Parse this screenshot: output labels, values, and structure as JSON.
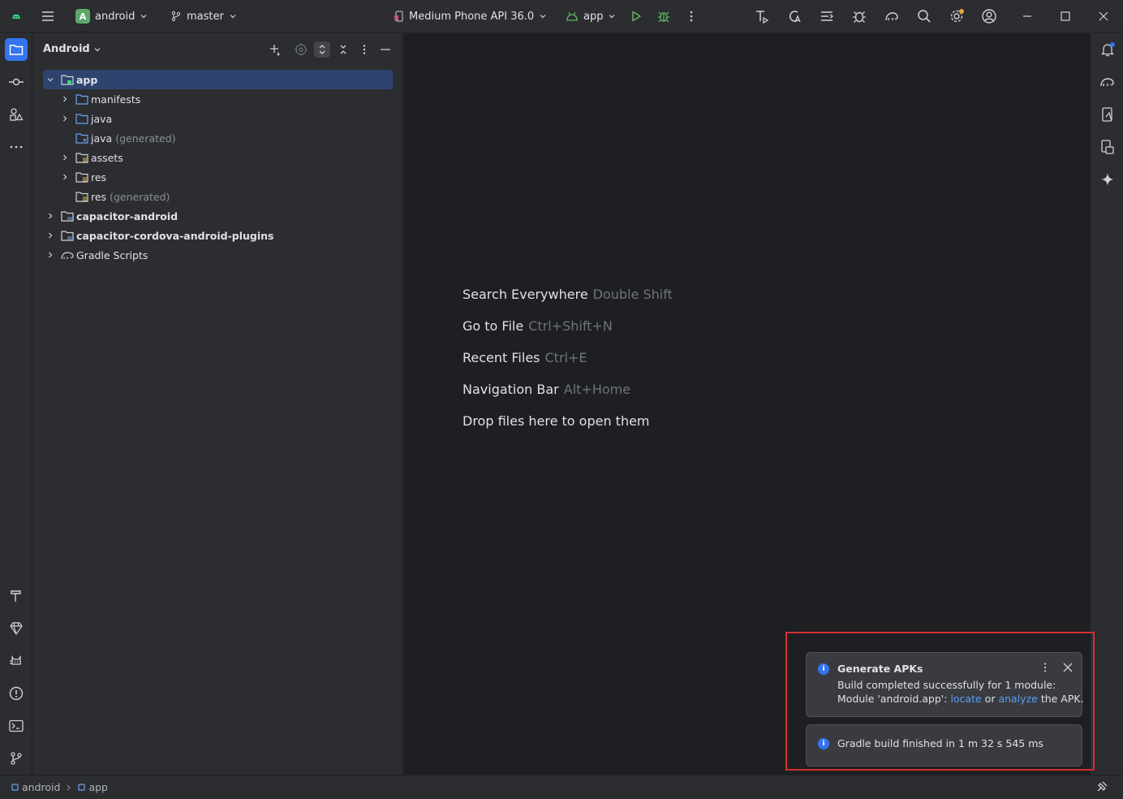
{
  "titlebar": {
    "project_badge": "A",
    "project_name": "android",
    "branch": "master",
    "device": "Medium Phone API 36.0",
    "run_config": "app"
  },
  "panel": {
    "title": "Android",
    "tree": [
      {
        "label": "app",
        "suffix": ""
      },
      {
        "label": "manifests",
        "suffix": ""
      },
      {
        "label": "java",
        "suffix": ""
      },
      {
        "label": "java",
        "suffix": "(generated)"
      },
      {
        "label": "assets",
        "suffix": ""
      },
      {
        "label": "res",
        "suffix": ""
      },
      {
        "label": "res",
        "suffix": "(generated)"
      },
      {
        "label": "capacitor-android",
        "suffix": ""
      },
      {
        "label": "capacitor-cordova-android-plugins",
        "suffix": ""
      },
      {
        "label": "Gradle Scripts",
        "suffix": ""
      }
    ]
  },
  "editor": {
    "hints": [
      {
        "action": "Search Everywhere",
        "shortcut": "Double Shift"
      },
      {
        "action": "Go to File",
        "shortcut": "Ctrl+Shift+N"
      },
      {
        "action": "Recent Files",
        "shortcut": "Ctrl+E"
      },
      {
        "action": "Navigation Bar",
        "shortcut": "Alt+Home"
      },
      {
        "action": "Drop files here to open them",
        "shortcut": ""
      }
    ]
  },
  "notifications": {
    "apk": {
      "title": "Generate APKs",
      "line1": "Build completed successfully for 1 module:",
      "line2_pre": "Module 'android.app':",
      "locate": "locate",
      "or": "or",
      "analyze": "analyze",
      "line2_post": "the APK."
    },
    "gradle": {
      "text": "Gradle build finished in 1 m 32 s 545 ms"
    }
  },
  "statusbar": {
    "crumb1": "android",
    "crumb2": "app"
  },
  "colors": {
    "accent": "#3574f0",
    "selection": "#2e436e",
    "link": "#589df6",
    "highlight_frame": "#d32f2f",
    "run_green": "#5fb85f"
  }
}
